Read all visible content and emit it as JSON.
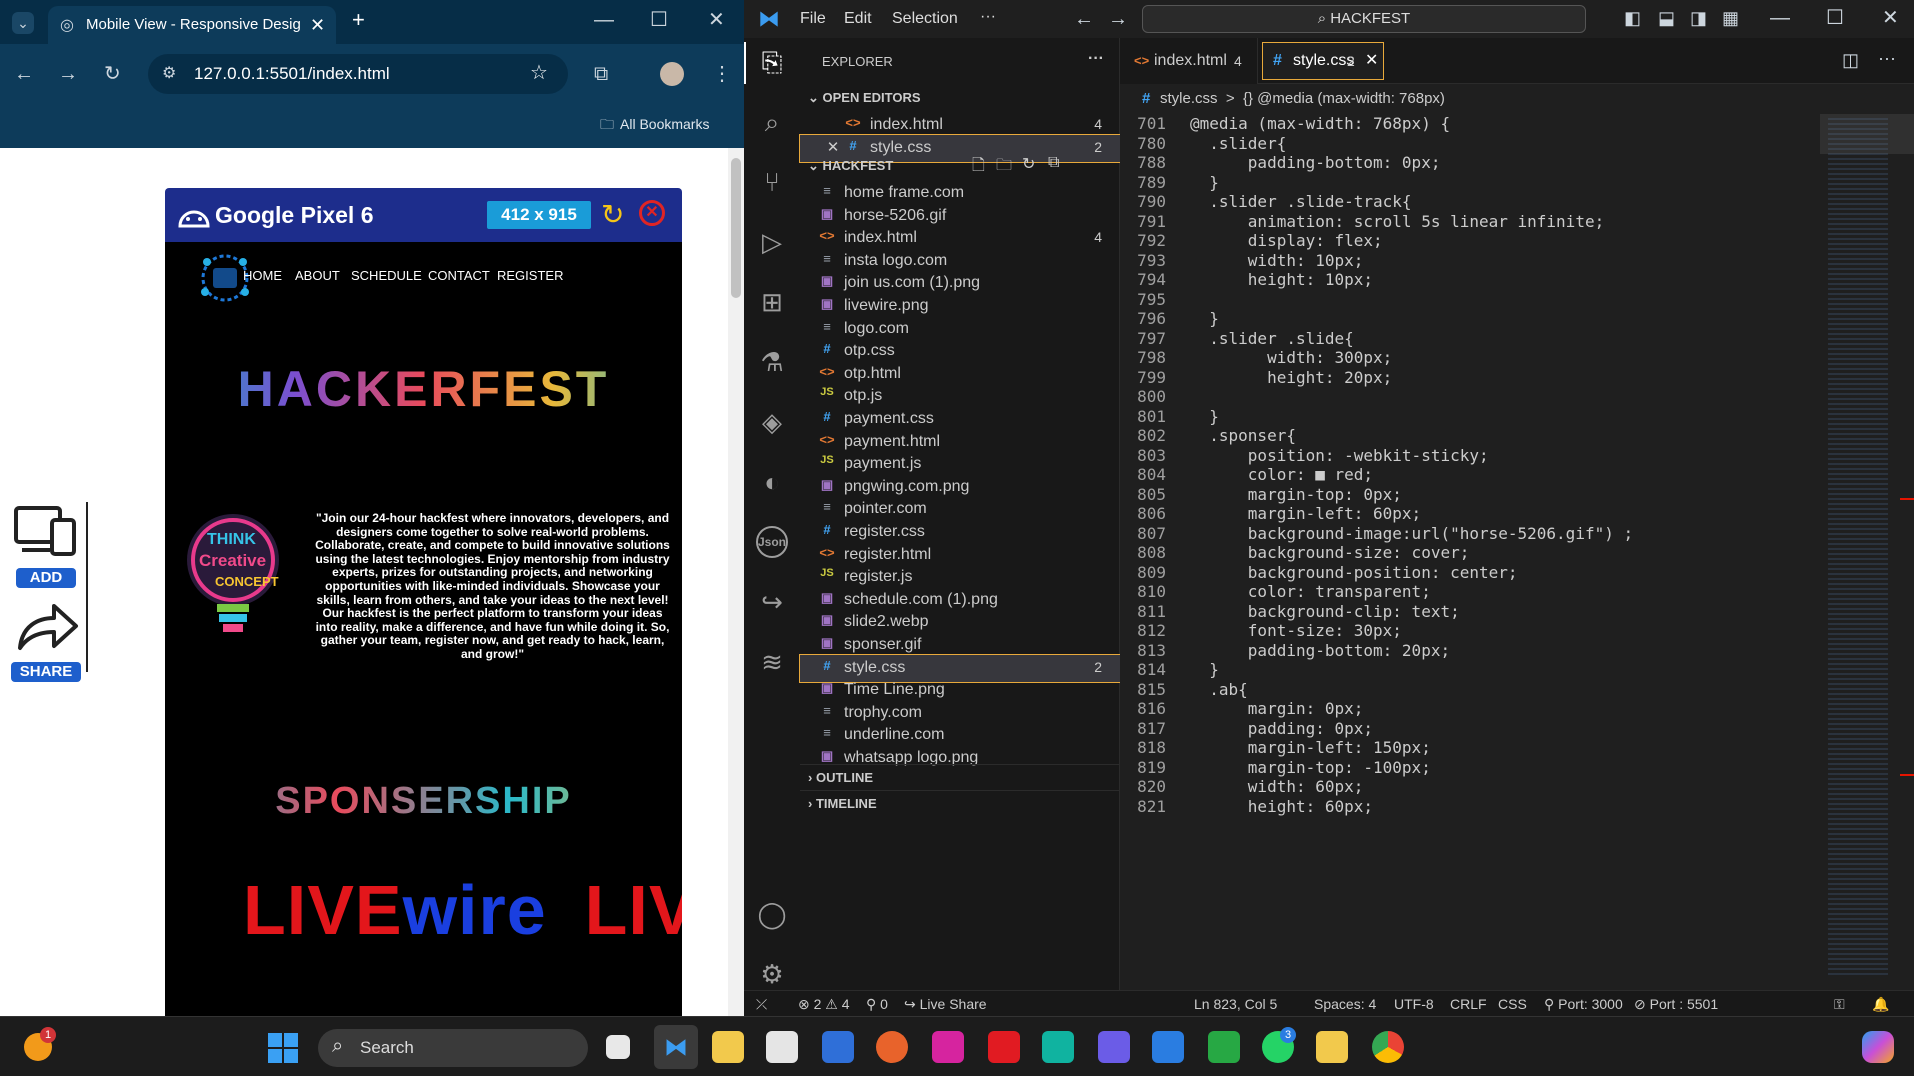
{
  "browser": {
    "tab_title": "Mobile View - Responsive Desig",
    "url": "127.0.0.1:5501/index.html",
    "bookmarks_label": "All Bookmarks"
  },
  "device": {
    "name": "Google Pixel 6",
    "size": "412 x 915"
  },
  "site": {
    "nav": [
      "HOME",
      "ABOUT",
      "SCHEDULE",
      "CONTACT",
      "REGISTER"
    ],
    "hero_title": "HACKERFEST",
    "intro": "\"Join our 24-hour hackfest where innovators, developers, and designers come together to solve real-world problems. Collaborate, create, and compete to build innovative solutions using the latest technologies. Enjoy mentorship from industry experts, prizes for outstanding projects, and networking opportunities with like-minded individuals. Showcase your skills, learn from others, and take your ideas to the next level! Our hackfest is the perfect platform to transform your ideas into reality, make a difference, and have fun while doing it. So, gather your team, register now, and get ready to hack, learn, and grow!\"",
    "sponsorship_title": "SPONSERSHIP",
    "livewire_a": "LIVE",
    "livewire_b": "wire",
    "livewire_c": "LIV"
  },
  "side_widget": {
    "add_label": "ADD",
    "share_label": "SHARE"
  },
  "vscode": {
    "menus": [
      "File",
      "Edit",
      "Selection",
      "···"
    ],
    "search": "HACKFEST",
    "explorer_title": "EXPLORER",
    "open_editors_label": "OPEN EDITORS",
    "open_editors": [
      {
        "name": "index.html",
        "type": "html",
        "badge": "4"
      },
      {
        "name": "style.css",
        "type": "css",
        "badge": "2"
      }
    ],
    "project_label": "HACKFEST",
    "files": [
      {
        "name": "home frame.com",
        "type": "txt",
        "badge": ""
      },
      {
        "name": "horse-5206.gif",
        "type": "img",
        "badge": ""
      },
      {
        "name": "index.html",
        "type": "html",
        "badge": "4"
      },
      {
        "name": "insta logo.com",
        "type": "txt",
        "badge": ""
      },
      {
        "name": "join us.com (1).png",
        "type": "img",
        "badge": ""
      },
      {
        "name": "livewire.png",
        "type": "img",
        "badge": ""
      },
      {
        "name": "logo.com",
        "type": "txt",
        "badge": ""
      },
      {
        "name": "otp.css",
        "type": "css",
        "badge": ""
      },
      {
        "name": "otp.html",
        "type": "html",
        "badge": ""
      },
      {
        "name": "otp.js",
        "type": "js",
        "badge": ""
      },
      {
        "name": "payment.css",
        "type": "css",
        "badge": ""
      },
      {
        "name": "payment.html",
        "type": "html",
        "badge": ""
      },
      {
        "name": "payment.js",
        "type": "js",
        "badge": ""
      },
      {
        "name": "pngwing.com.png",
        "type": "img",
        "badge": ""
      },
      {
        "name": "pointer.com",
        "type": "txt",
        "badge": ""
      },
      {
        "name": "register.css",
        "type": "css",
        "badge": ""
      },
      {
        "name": "register.html",
        "type": "html",
        "badge": ""
      },
      {
        "name": "register.js",
        "type": "js",
        "badge": ""
      },
      {
        "name": "schedule.com (1).png",
        "type": "img",
        "badge": ""
      },
      {
        "name": "slide2.webp",
        "type": "img",
        "badge": ""
      },
      {
        "name": "sponser.gif",
        "type": "img",
        "badge": ""
      },
      {
        "name": "style.css",
        "type": "css",
        "badge": "2"
      },
      {
        "name": "Time Line.png",
        "type": "img",
        "badge": ""
      },
      {
        "name": "trophy.com",
        "type": "txt",
        "badge": ""
      },
      {
        "name": "underline.com",
        "type": "txt",
        "badge": ""
      },
      {
        "name": "whatsapp logo.png",
        "type": "img",
        "badge": ""
      }
    ],
    "outline_label": "OUTLINE",
    "timeline_label": "TIMELINE",
    "tabs": [
      {
        "name": "index.html",
        "badge": "4"
      },
      {
        "name": "style.css",
        "badge": "2"
      }
    ],
    "breadcrumb": "style.css  >  {} @media (max-width: 768px)",
    "code_lines": [
      {
        "n": "701",
        "t": "@media (max-width: 768px) {"
      },
      {
        "n": "780",
        "t": "  .slider{"
      },
      {
        "n": "788",
        "t": "      padding-bottom: 0px;"
      },
      {
        "n": "789",
        "t": "  }"
      },
      {
        "n": "790",
        "t": "  .slider .slide-track{"
      },
      {
        "n": "791",
        "t": "      animation: scroll 5s linear infinite;"
      },
      {
        "n": "792",
        "t": "      display: flex;"
      },
      {
        "n": "793",
        "t": "      width: 10px;"
      },
      {
        "n": "794",
        "t": "      height: 10px;"
      },
      {
        "n": "795",
        "t": ""
      },
      {
        "n": "796",
        "t": "  }"
      },
      {
        "n": "797",
        "t": "  .slider .slide{"
      },
      {
        "n": "798",
        "t": "        width: 300px;"
      },
      {
        "n": "799",
        "t": "        height: 20px;"
      },
      {
        "n": "800",
        "t": ""
      },
      {
        "n": "801",
        "t": "  }"
      },
      {
        "n": "802",
        "t": "  .sponser{"
      },
      {
        "n": "803",
        "t": "      position: -webkit-sticky;"
      },
      {
        "n": "804",
        "t": "      color: ■ red;"
      },
      {
        "n": "805",
        "t": "      margin-top: 0px;"
      },
      {
        "n": "806",
        "t": "      margin-left: 60px;"
      },
      {
        "n": "807",
        "t": "      background-image:url(\"horse-5206.gif\") ;"
      },
      {
        "n": "808",
        "t": "      background-size: cover;"
      },
      {
        "n": "809",
        "t": "      background-position: center;"
      },
      {
        "n": "810",
        "t": "      color: transparent;"
      },
      {
        "n": "811",
        "t": "      background-clip: text;"
      },
      {
        "n": "812",
        "t": "      font-size: 30px;"
      },
      {
        "n": "813",
        "t": "      padding-bottom: 20px;"
      },
      {
        "n": "814",
        "t": "  }"
      },
      {
        "n": "815",
        "t": "  .ab{"
      },
      {
        "n": "816",
        "t": "      margin: 0px;"
      },
      {
        "n": "817",
        "t": "      padding: 0px;"
      },
      {
        "n": "818",
        "t": "      margin-left: 150px;"
      },
      {
        "n": "819",
        "t": "      margin-top: -100px;"
      },
      {
        "n": "820",
        "t": "      width: 60px;"
      },
      {
        "n": "821",
        "t": "      height: 60px;"
      }
    ],
    "status": {
      "errors": "2",
      "warnings": "4",
      "ports": "0",
      "live_share": "Live Share",
      "position": "Ln 823, Col 5",
      "spaces": "Spaces: 4",
      "encoding": "UTF-8",
      "eol": "CRLF",
      "language": "CSS",
      "port1": "Port: 3000",
      "port2": "Port : 5501"
    }
  },
  "taskbar": {
    "search_label": "Search",
    "weather_badge": "1",
    "whatsapp_badge": "3"
  },
  "colors": {
    "accent_blue": "#0078d4",
    "device_header": "#1d2d8c",
    "selection_outline": "#e8a93b"
  }
}
